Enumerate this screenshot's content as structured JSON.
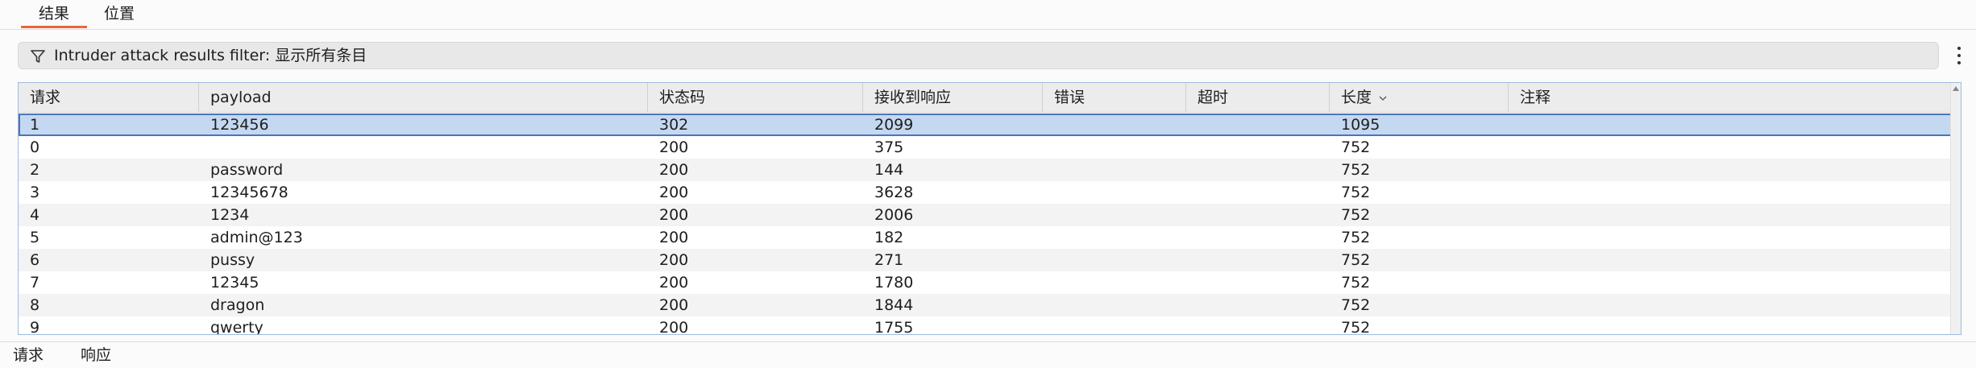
{
  "top_tabs": [
    {
      "label": "结果",
      "active": true
    },
    {
      "label": "位置",
      "active": false
    }
  ],
  "filter": {
    "icon": "filter-icon",
    "text": "Intruder attack results filter: 显示所有条目"
  },
  "table": {
    "columns": [
      "请求",
      "payload",
      "状态码",
      "接收到响应",
      "错误",
      "超时",
      "长度",
      "注释"
    ],
    "sorted_column": "长度",
    "rows": [
      [
        "1",
        "123456",
        "302",
        "2099",
        "",
        "",
        "1095",
        ""
      ],
      [
        "0",
        "",
        "200",
        "375",
        "",
        "",
        "752",
        ""
      ],
      [
        "2",
        "password",
        "200",
        "144",
        "",
        "",
        "752",
        ""
      ],
      [
        "3",
        "12345678",
        "200",
        "3628",
        "",
        "",
        "752",
        ""
      ],
      [
        "4",
        "1234",
        "200",
        "2006",
        "",
        "",
        "752",
        ""
      ],
      [
        "5",
        "admin@123",
        "200",
        "182",
        "",
        "",
        "752",
        ""
      ],
      [
        "6",
        "pussy",
        "200",
        "271",
        "",
        "",
        "752",
        ""
      ],
      [
        "7",
        "12345",
        "200",
        "1780",
        "",
        "",
        "752",
        ""
      ],
      [
        "8",
        "dragon",
        "200",
        "1844",
        "",
        "",
        "752",
        ""
      ],
      [
        "9",
        "qwerty",
        "200",
        "1755",
        "",
        "",
        "752",
        ""
      ]
    ],
    "selected_row": 0
  },
  "bottom_tabs": [
    "请求",
    "响应"
  ]
}
